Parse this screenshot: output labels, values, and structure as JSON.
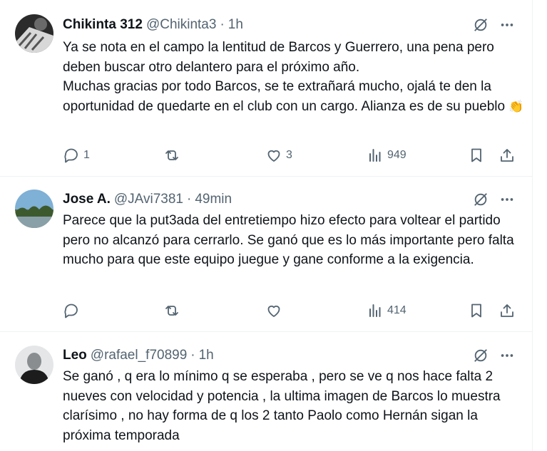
{
  "colors": {
    "text": "#0f1419",
    "secondary": "#536471",
    "divider": "#eff3f4",
    "background": "#ffffff"
  },
  "tweets": [
    {
      "name": "Chikinta 312",
      "handle": "@Chikinta3",
      "dot": "·",
      "time": "1h",
      "avatar_icon": "avatar-photo-dark",
      "text_lines": [
        "Ya se nota en el campo la lentitud de Barcos y Guerrero, una pena pero deben buscar otro delantero para el próximo año.",
        "Muchas gracias por todo Barcos, se te extrañará mucho, ojalá te den la oportunidad de quedarte en el club con un cargo. Alianza es de su pueblo"
      ],
      "emoji": "👏",
      "replies": "1",
      "retweets": "",
      "likes": "3",
      "views": "949"
    },
    {
      "name": "Jose A.",
      "handle": "@JAvi7381",
      "dot": "·",
      "time": "49min",
      "avatar_icon": "avatar-photo-landscape",
      "text_lines": [
        "Parece que la put3ada del entretiempo hizo efecto para voltear el partido pero no alcanzó para cerrarlo. Se ganó que es lo más importante pero falta mucho para que este equipo juegue y gane conforme a la exigencia."
      ],
      "replies": "",
      "retweets": "",
      "likes": "",
      "views": "414"
    },
    {
      "name": "Leo",
      "handle": "@rafael_f70899",
      "dot": "·",
      "time": "1h",
      "avatar_icon": "avatar-photo-person",
      "text_lines": [
        "Se ganó , q era lo mínimo q se esperaba , pero se ve q nos hace falta 2 nueves con velocidad y potencia , la ultima imagen de Barcos lo muestra clarísimo , no hay forma de q los 2 tanto Paolo como Hernán sigan la próxima temporada"
      ]
    }
  ]
}
